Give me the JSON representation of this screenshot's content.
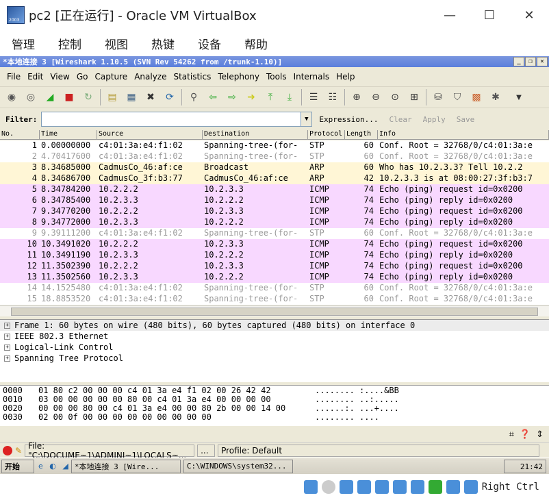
{
  "vbox": {
    "title": "pc2 [正在运行] - Oracle VM VirtualBox",
    "menu": [
      "管理",
      "控制",
      "视图",
      "热键",
      "设备",
      "帮助"
    ],
    "controls": {
      "minimize": "—",
      "maximize": "☐",
      "close": "✕"
    },
    "host_key": "Right Ctrl"
  },
  "wireshark": {
    "title": "*本地连接 3   [Wireshark 1.10.5  (SVN Rev 54262 from /trunk-1.10)]",
    "menu": [
      "File",
      "Edit",
      "View",
      "Go",
      "Capture",
      "Analyze",
      "Statistics",
      "Telephony",
      "Tools",
      "Internals",
      "Help"
    ],
    "filter": {
      "label": "Filter:",
      "value": "",
      "expression": "Expression...",
      "clear": "Clear",
      "apply": "Apply",
      "save": "Save"
    },
    "columns": [
      "No.",
      "Time",
      "Source",
      "Destination",
      "Protocol",
      "Length",
      "Info"
    ],
    "packets": [
      {
        "no": "1",
        "time": "0.00000000",
        "src": "c4:01:3a:e4:f1:02",
        "dst": "Spanning-tree-(for-",
        "proto": "STP",
        "len": "60",
        "info": "Conf. Root = 32768/0/c4:01:3a:e",
        "cls": "stp-sel"
      },
      {
        "no": "2",
        "time": "4.70417600",
        "src": "c4:01:3a:e4:f1:02",
        "dst": "Spanning-tree-(for-",
        "proto": "STP",
        "len": "60",
        "info": "Conf. Root = 32768/0/c4:01:3a:e",
        "cls": "stp"
      },
      {
        "no": "3",
        "time": "8.34685000",
        "src": "CadmusCo_46:af:ce",
        "dst": "Broadcast",
        "proto": "ARP",
        "len": "60",
        "info": "Who has 10.2.3.3?  Tell 10.2.2",
        "cls": "arp"
      },
      {
        "no": "4",
        "time": "8.34686700",
        "src": "CadmusCo_3f:b3:77",
        "dst": "CadmusCo_46:af:ce",
        "proto": "ARP",
        "len": "42",
        "info": "10.2.3.3 is at 08:00:27:3f:b3:7",
        "cls": "arp"
      },
      {
        "no": "5",
        "time": "8.34784200",
        "src": "10.2.2.2",
        "dst": "10.2.3.3",
        "proto": "ICMP",
        "len": "74",
        "info": "Echo (ping) request  id=0x0200",
        "cls": "icmp"
      },
      {
        "no": "6",
        "time": "8.34785400",
        "src": "10.2.3.3",
        "dst": "10.2.2.2",
        "proto": "ICMP",
        "len": "74",
        "info": "Echo (ping) reply    id=0x0200",
        "cls": "icmp"
      },
      {
        "no": "7",
        "time": "9.34770200",
        "src": "10.2.2.2",
        "dst": "10.2.3.3",
        "proto": "ICMP",
        "len": "74",
        "info": "Echo (ping) request  id=0x0200",
        "cls": "icmp"
      },
      {
        "no": "8",
        "time": "9.34772000",
        "src": "10.2.3.3",
        "dst": "10.2.2.2",
        "proto": "ICMP",
        "len": "74",
        "info": "Echo (ping) reply    id=0x0200",
        "cls": "icmp"
      },
      {
        "no": "9",
        "time": "9.39111200",
        "src": "c4:01:3a:e4:f1:02",
        "dst": "Spanning-tree-(for-",
        "proto": "STP",
        "len": "60",
        "info": "Conf. Root = 32768/0/c4:01:3a:e",
        "cls": "stp"
      },
      {
        "no": "10",
        "time": "10.3491020",
        "src": "10.2.2.2",
        "dst": "10.2.3.3",
        "proto": "ICMP",
        "len": "74",
        "info": "Echo (ping) request  id=0x0200",
        "cls": "icmp"
      },
      {
        "no": "11",
        "time": "10.3491190",
        "src": "10.2.3.3",
        "dst": "10.2.2.2",
        "proto": "ICMP",
        "len": "74",
        "info": "Echo (ping) reply    id=0x0200",
        "cls": "icmp"
      },
      {
        "no": "12",
        "time": "11.3502390",
        "src": "10.2.2.2",
        "dst": "10.2.3.3",
        "proto": "ICMP",
        "len": "74",
        "info": "Echo (ping) request  id=0x0200",
        "cls": "icmp"
      },
      {
        "no": "13",
        "time": "11.3502560",
        "src": "10.2.3.3",
        "dst": "10.2.2.2",
        "proto": "ICMP",
        "len": "74",
        "info": "Echo (ping) reply    id=0x0200",
        "cls": "icmp"
      },
      {
        "no": "14",
        "time": "14.1525480",
        "src": "c4:01:3a:e4:f1:02",
        "dst": "Spanning-tree-(for-",
        "proto": "STP",
        "len": "60",
        "info": "Conf. Root = 32768/0/c4:01:3a:e",
        "cls": "stp"
      },
      {
        "no": "15",
        "time": "18.8853520",
        "src": "c4:01:3a:e4:f1:02",
        "dst": "Spanning-tree-(for-",
        "proto": "STP",
        "len": "60",
        "info": "Conf. Root = 32768/0/c4:01:3a:e",
        "cls": "stp"
      }
    ],
    "details": [
      "Frame 1: 60 bytes on wire (480 bits), 60 bytes captured (480 bits) on interface 0",
      "IEEE 802.3 Ethernet",
      "Logical-Link Control",
      "Spanning Tree Protocol"
    ],
    "hex": [
      {
        "off": "0000",
        "bytes": "01 80 c2 00 00 00 c4 01  3a e4 f1 02 00 26 42 42",
        "ascii": "........ :....&BB"
      },
      {
        "off": "0010",
        "bytes": "03 00 00 00 00 00 80 00  c4 01 3a e4 00 00 00 00",
        "ascii": "........ ..:....."
      },
      {
        "off": "0020",
        "bytes": "00 00 00 80 00 c4 01 3a  e4 00 00 80 2b 00 00 14 00",
        "ascii": "......:. ...+...."
      },
      {
        "off": "0030",
        "bytes": "02 00 0f 00 00 00 00 00  00 00 00 00",
        "ascii": "........ ...."
      }
    ],
    "status": {
      "file": "File: \"C:\\DOCUME~1\\ADMINI~1\\LOCALS~...",
      "ellipsis": "...",
      "profile": "Profile: Default"
    }
  },
  "taskbar": {
    "start": "开始",
    "task1": "*本地连接 3   [Wire...",
    "task2": "C:\\WINDOWS\\system32...",
    "clock": "21:42"
  },
  "colors": {
    "icmp": "#f8d8ff",
    "arp": "#fff6d6",
    "stp_text": "#9a9a9a",
    "xp_title": "#5a7edc"
  }
}
